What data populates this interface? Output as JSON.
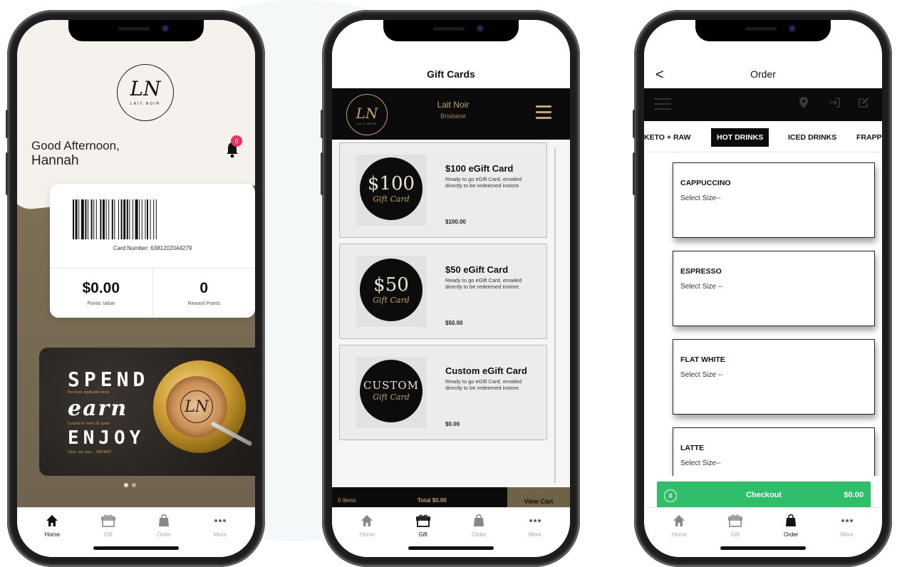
{
  "phone_home": {
    "logo_monogram": "LN",
    "logo_word": "LAIT NOIR",
    "greeting": "Good Afternoon,",
    "user_name": "Hannah",
    "notification_count": "0",
    "card_number": "Card Number: 6381202044279",
    "points_value": "$0.00",
    "points_value_label": "Points Value",
    "reward_points": "0",
    "reward_points_label": "Reward Points",
    "promo": {
      "spend": "SPEND",
      "spend_sub": "Purchase applicable items",
      "earn": "earn",
      "earn_sub": "5 points for every $1 spent",
      "enjoy": "ENJOY",
      "enjoy_sub": "Drink, eat, play ... REPEAT!",
      "cup_monogram": "LN"
    }
  },
  "phone_gift": {
    "title": "Gift Cards",
    "logo_monogram": "LN",
    "logo_word": "LAIT NOIR",
    "store_name": "Lait Noir",
    "store_location": "Brisbane",
    "cards": [
      {
        "amount_art": "$100",
        "script": "Gift Card",
        "title": "$100 eGift Card",
        "desc": "Ready to go eGift Card, emailed directly to be redeemed instore.",
        "price": "$100.00"
      },
      {
        "amount_art": "$50",
        "script": "Gift Card",
        "title": "$50 eGift Card",
        "desc": "Ready to go eGift Card, emailed directly to be redeemed instore.",
        "price": "$50.00"
      },
      {
        "amount_art": "CUSTOM",
        "script": "Gift Card",
        "title": "Custom eGift Card",
        "desc": "Ready to go eGift Card, emailed directly to be redeemed instore.",
        "price": "$0.00"
      }
    ],
    "cart_items": "0 items",
    "cart_total": "Total $0.00",
    "view_cart": "View Cart"
  },
  "phone_order": {
    "title": "Order",
    "back": "<",
    "categories": [
      "KETO + RAW",
      "HOT DRINKS",
      "ICED DRINKS",
      "FRAPPE"
    ],
    "active_category": "HOT DRINKS",
    "items": [
      {
        "name": "CAPPUCCINO",
        "size": "Select Size--"
      },
      {
        "name": "ESPRESSO",
        "size": "Select Size --"
      },
      {
        "name": "FLAT WHITE",
        "size": "Select Size --"
      },
      {
        "name": "LATTE",
        "size": "Select Size--"
      }
    ],
    "checkout_count": "0",
    "checkout_label": "Checkout",
    "checkout_amount": "$0.00"
  },
  "tabbar": {
    "home": "Home",
    "gift": "Gift",
    "order": "Order",
    "more": "More"
  },
  "colors": {
    "gold": "#c2a56c",
    "checkout_green": "#2fbf6a",
    "badge_pink": "#e8335b"
  }
}
